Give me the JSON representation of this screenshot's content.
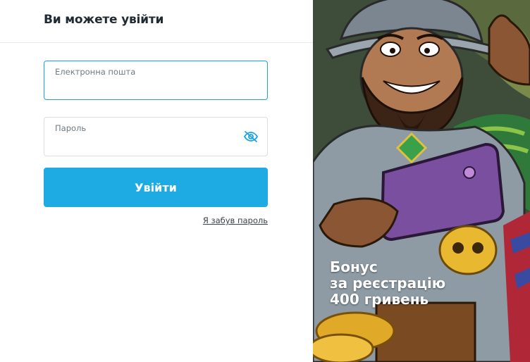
{
  "login": {
    "title": "Ви можете увійти",
    "email_label": "Електронна пошта",
    "email_value": "",
    "password_label": "Пароль",
    "password_value": "",
    "password_toggle_icon": "eye-slash-icon",
    "submit_label": "Увійти",
    "forgot_label": "Я забув пароль"
  },
  "promo": {
    "line1": "Бонус",
    "line2": "за реєстрацію",
    "line3": "400 гривень",
    "illustration": "pirate-with-phone"
  },
  "colors": {
    "accent": "#1eaae2",
    "focus_border": "#1aa3e0"
  }
}
